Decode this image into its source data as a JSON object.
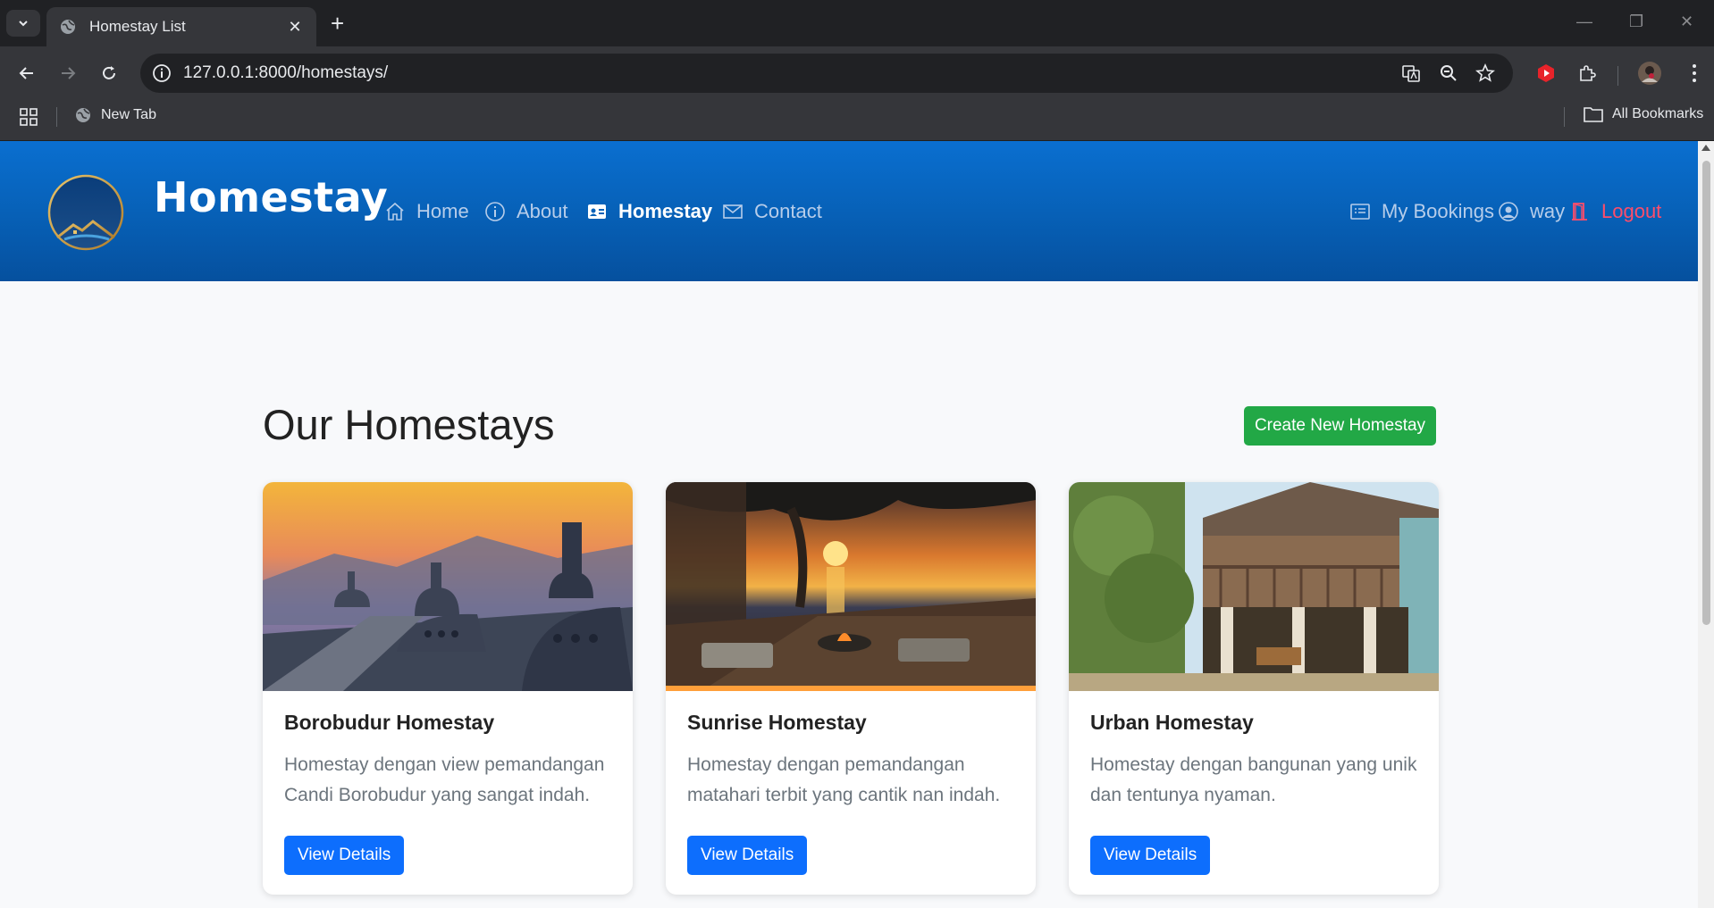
{
  "browser": {
    "tab_title": "Homestay List",
    "tab_close": "✕",
    "new_tab": "+",
    "url": "127.0.0.1:8000/homestays/",
    "bookmark_new_tab": "New Tab",
    "bookmark_all": "All Bookmarks"
  },
  "site": {
    "brand": "Homestay",
    "nav": {
      "home": "Home",
      "about": "About",
      "homestay": "Homestay",
      "contact": "Contact",
      "bookings": "My Bookings",
      "user": "way",
      "logout": "Logout"
    },
    "colors": {
      "header": "#0a6fd0",
      "create": "#22a846",
      "primary": "#0d6efd",
      "logout": "#ff4d6a"
    }
  },
  "main": {
    "heading": "Our Homestays",
    "create_label": "Create New Homestay",
    "cards": [
      {
        "title": "Borobudur Homestay",
        "desc": "Homestay dengan view pemandangan Candi Borobudur yang sangat indah.",
        "button": "View Details"
      },
      {
        "title": "Sunrise Homestay",
        "desc": "Homestay dengan pemandangan matahari terbit yang cantik nan indah.",
        "button": "View Details"
      },
      {
        "title": "Urban Homestay",
        "desc": "Homestay dengan bangunan yang unik dan tentunya nyaman.",
        "button": "View Details"
      }
    ]
  }
}
